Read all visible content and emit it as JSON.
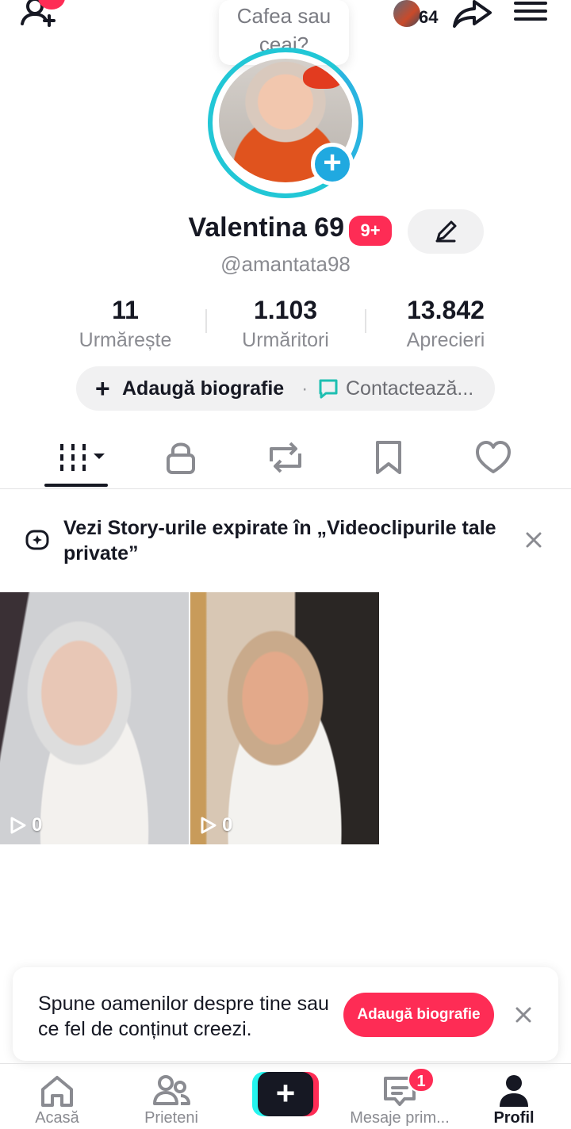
{
  "header": {
    "tooltip": "Cafea sau ceai?",
    "visitor_count": "64"
  },
  "profile": {
    "display_name": "Valentina 69",
    "name_badge": "9+",
    "username": "@amantata98"
  },
  "stats": [
    {
      "value": "11",
      "label": "Urmărește"
    },
    {
      "value": "1.103",
      "label": "Urmăritori"
    },
    {
      "value": "13.842",
      "label": "Aprecieri"
    }
  ],
  "bio_row": {
    "add_bio": "Adaugă biografie",
    "separator": "·",
    "contact": "Contactează..."
  },
  "tabs": [
    {
      "icon": "videos-grid-icon"
    },
    {
      "icon": "lock-icon"
    },
    {
      "icon": "repost-icon"
    },
    {
      "icon": "bookmark-icon"
    },
    {
      "icon": "heart-icon"
    }
  ],
  "story_banner": {
    "text": "Vezi Story-urile expirate în „Videoclipurile tale private”"
  },
  "videos": [
    {
      "views": "0"
    },
    {
      "views": "0"
    }
  ],
  "bio_prompt": {
    "text": "Spune oamenilor despre tine sau ce fel de conținut creezi.",
    "button": "Adaugă biografie"
  },
  "nav": {
    "home": "Acasă",
    "friends": "Prieteni",
    "create": "+",
    "inbox": "Mesaje prim...",
    "inbox_badge": "1",
    "profile": "Profil"
  },
  "colors": {
    "accent": "#fe2c55",
    "ring": "#22c7d6",
    "text": "#161823",
    "muted": "#8a8b91"
  }
}
